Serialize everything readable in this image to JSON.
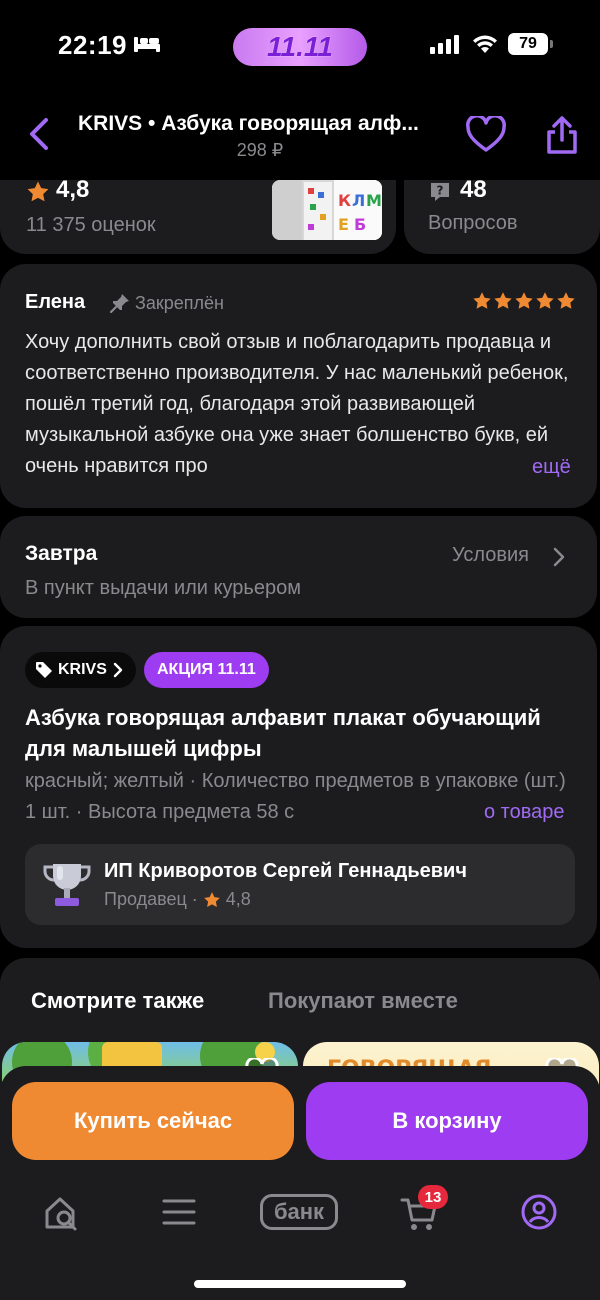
{
  "status_bar": {
    "time": "22:19",
    "promo": "11.11",
    "battery": "79"
  },
  "header": {
    "title": "KRIVS • Азбука говорящая алф...",
    "price": "298 ₽"
  },
  "rating": {
    "value": "4,8",
    "count": "11 375 оценок"
  },
  "questions": {
    "value": "48",
    "label": "Вопросов"
  },
  "review": {
    "author": "Елена",
    "pinned": "Закреплён",
    "stars": 5,
    "text": "Хочу дополнить свой отзыв и поблагодарить продавца и соответственно производителя. У нас маленький ребенок, пошёл третий год, благодаря этой развивающей музыкальной азбуке она уже знает болшенство букв, ей очень нравится про",
    "more": "ещё"
  },
  "delivery": {
    "title": "Завтра",
    "subtitle": "В пункт выдачи или курьером",
    "conditions": "Условия"
  },
  "product": {
    "brand": "KRIVS",
    "promo": "АКЦИЯ 11.11",
    "title": "Азбука говорящая алфавит плакат обучающий для малышей цифры",
    "specs": "красный; желтый · Количество предметов в упаковке (шт.) 1 шт. · Высота предмета 58 с",
    "more": "о товаре"
  },
  "seller": {
    "name": "ИП Криворотов Сергей Геннадьевич",
    "role": "Продавец",
    "rating": "4,8"
  },
  "recommendations": {
    "tab_active": "Смотрите также",
    "tab_inactive": "Покупают вместе",
    "card2_text": "ГОВОРЯЩАЯ"
  },
  "actions": {
    "buy_now": "Купить сейчас",
    "add_to_cart": "В корзину"
  },
  "tabbar": {
    "bank": "банк",
    "cart_count": "13"
  },
  "colors": {
    "accent": "#9d3cf0",
    "orange": "#f08a32",
    "star": "#f08a32",
    "badge": "#e6283c",
    "card": "#1c1c1e"
  }
}
